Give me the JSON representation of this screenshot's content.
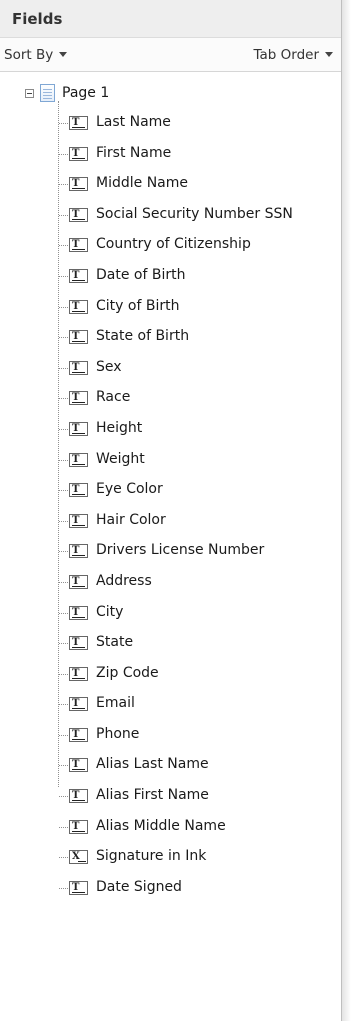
{
  "panel": {
    "title": "Fields"
  },
  "toolbar": {
    "sort_by": "Sort By",
    "tab_order": "Tab Order"
  },
  "tree": {
    "page": {
      "label": "Page 1"
    },
    "items": [
      {
        "label": "Last Name",
        "icon": "text-field-icon"
      },
      {
        "label": "First Name",
        "icon": "text-field-icon"
      },
      {
        "label": "Middle Name",
        "icon": "text-field-icon"
      },
      {
        "label": "Social Security Number  SSN",
        "icon": "text-field-icon"
      },
      {
        "label": "Country of Citizenship",
        "icon": "text-field-icon"
      },
      {
        "label": "Date of Birth",
        "icon": "text-field-icon"
      },
      {
        "label": "City of Birth",
        "icon": "text-field-icon"
      },
      {
        "label": "State of Birth",
        "icon": "text-field-icon"
      },
      {
        "label": "Sex",
        "icon": "text-field-icon"
      },
      {
        "label": "Race",
        "icon": "text-field-icon"
      },
      {
        "label": "Height",
        "icon": "text-field-icon"
      },
      {
        "label": "Weight",
        "icon": "text-field-icon"
      },
      {
        "label": "Eye Color",
        "icon": "text-field-icon"
      },
      {
        "label": "Hair Color",
        "icon": "text-field-icon"
      },
      {
        "label": "Drivers License Number",
        "icon": "text-field-icon"
      },
      {
        "label": "Address",
        "icon": "text-field-icon"
      },
      {
        "label": "City",
        "icon": "text-field-icon"
      },
      {
        "label": "State",
        "icon": "text-field-icon"
      },
      {
        "label": "Zip Code",
        "icon": "text-field-icon"
      },
      {
        "label": "Email",
        "icon": "text-field-icon"
      },
      {
        "label": "Phone",
        "icon": "text-field-icon"
      },
      {
        "label": "Alias Last Name",
        "icon": "text-field-icon"
      },
      {
        "label": "Alias First Name",
        "icon": "text-field-icon"
      },
      {
        "label": "Alias Middle Name",
        "icon": "text-field-icon"
      },
      {
        "label": "Signature in Ink",
        "icon": "signature-field-icon"
      },
      {
        "label": "Date Signed",
        "icon": "text-field-icon"
      }
    ]
  }
}
